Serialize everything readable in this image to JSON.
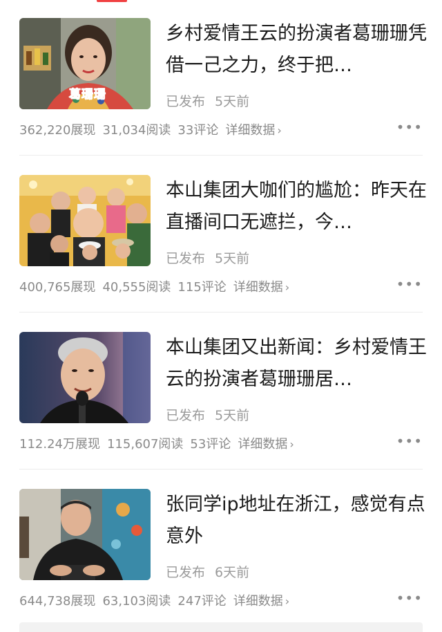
{
  "colors": {
    "accent": "#f04142",
    "title": "#1a1a1a",
    "meta": "#9a9a9a"
  },
  "articles": [
    {
      "thumb_caption": "葛珊珊",
      "title": "乡村爱情王云的扮演者葛珊珊凭借一己之力，终于把…",
      "status": "已发布",
      "time": "5天前",
      "impressions": "362,220展现",
      "reads": "31,034阅读",
      "comments": "33评论",
      "detail": "详细数据",
      "more_icon": "more-icon"
    },
    {
      "thumb_caption": "",
      "title": "本山集团大咖们的尴尬：昨天在直播间口无遮拦，今…",
      "status": "已发布",
      "time": "5天前",
      "impressions": "400,765展现",
      "reads": "40,555阅读",
      "comments": "115评论",
      "detail": "详细数据",
      "more_icon": "more-icon"
    },
    {
      "thumb_caption": "",
      "title": "本山集团又出新闻：乡村爱情王云的扮演者葛珊珊居…",
      "status": "已发布",
      "time": "5天前",
      "impressions": "112.24万展现",
      "reads": "115,607阅读",
      "comments": "53评论",
      "detail": "详细数据",
      "more_icon": "more-icon"
    },
    {
      "thumb_caption": "",
      "title": "张同学ip地址在浙江，感觉有点意外",
      "status": "已发布",
      "time": "6天前",
      "impressions": "644,738展现",
      "reads": "63,103阅读",
      "comments": "247评论",
      "detail": "详细数据",
      "more_icon": "more-icon"
    }
  ]
}
